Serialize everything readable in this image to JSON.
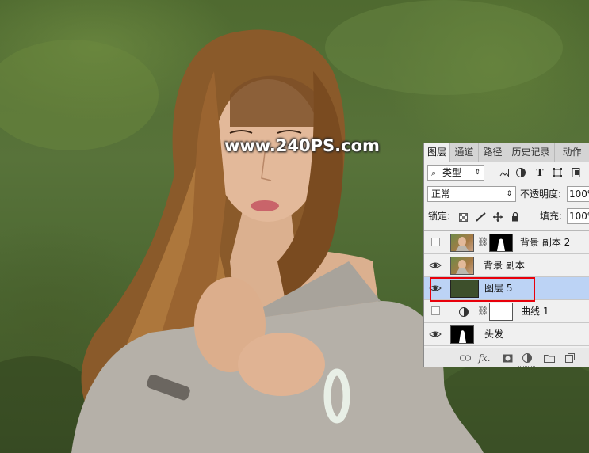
{
  "watermark": "www.240PS.com",
  "panel": {
    "tabs": [
      "图层",
      "通道",
      "路径",
      "历史记录",
      "动作"
    ],
    "filter_kind": "类型",
    "blend_mode": "正常",
    "opacity_label": "不透明度:",
    "opacity_value": "100%",
    "lock_label": "锁定:",
    "fill_label": "填充:",
    "fill_value": "100%",
    "layers": [
      {
        "name": "背景 副本 2",
        "visible": false,
        "selected": false
      },
      {
        "name": "背景 副本",
        "visible": true,
        "selected": false
      },
      {
        "name": "图层 5",
        "visible": true,
        "selected": true
      },
      {
        "name": "曲线 1",
        "visible": false,
        "selected": false
      },
      {
        "name": "头发",
        "visible": true,
        "selected": false
      }
    ],
    "footer_fx_label": "fx.",
    "layer5_color": "#3d4f2b",
    "selection_color": "#bcd3f5",
    "highlight_color": "#e8000b"
  }
}
